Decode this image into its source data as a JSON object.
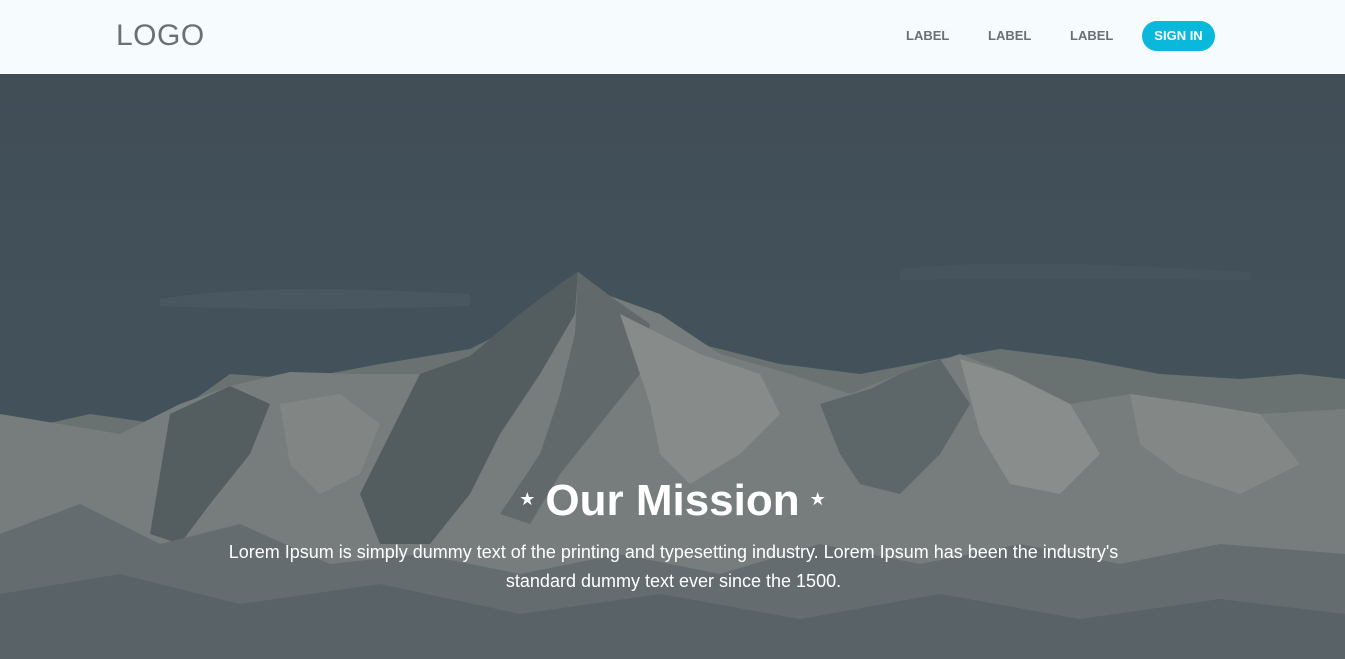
{
  "header": {
    "logo": "LOGO",
    "nav": [
      "LABEL",
      "LABEL",
      "LABEL"
    ],
    "signin_label": "SIGN IN",
    "signin_color": "#0ab8dc"
  },
  "hero": {
    "title": "Our Mission",
    "star_left": "★",
    "star_right": "★",
    "description": "Lorem Ipsum is simply dummy text of the printing and typesetting industry. Lorem Ipsum has been the industry's standard dummy text ever since the 1500."
  }
}
